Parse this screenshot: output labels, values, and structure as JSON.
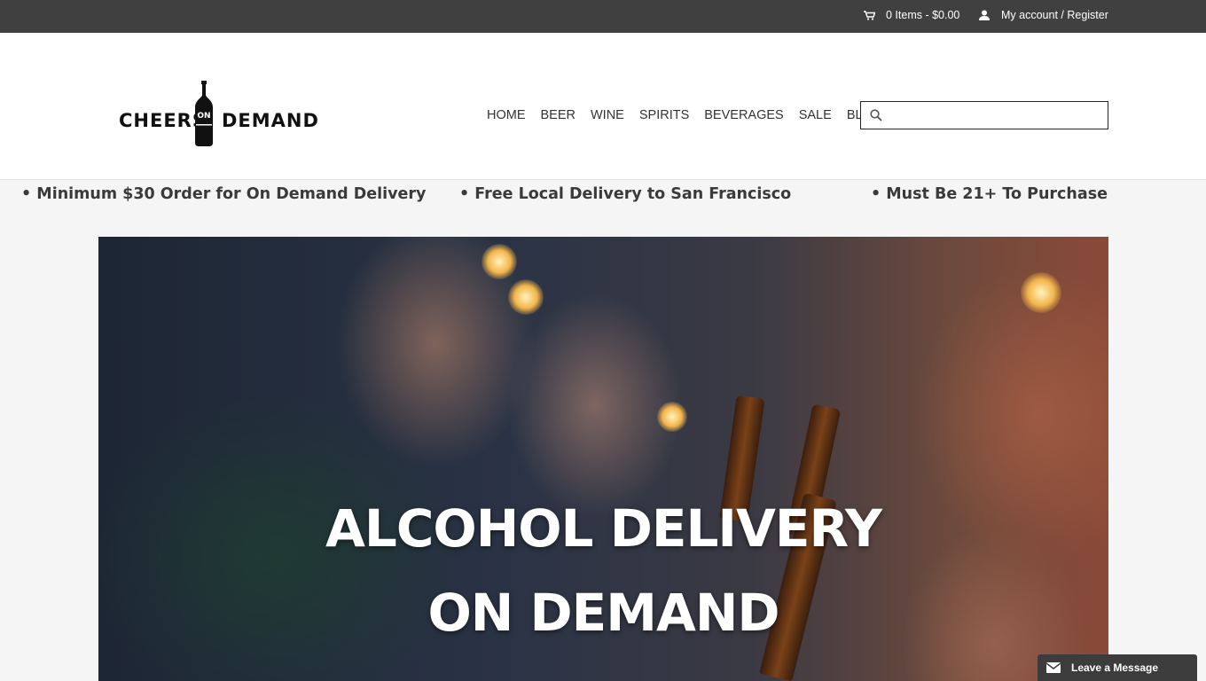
{
  "topbar": {
    "cart_label": "0 Items - $0.00",
    "account_label": "My account / Register"
  },
  "brand": {
    "logo_word_1": "CHEERS",
    "logo_word_2": "DEMAND",
    "logo_badge": "ON"
  },
  "nav": {
    "items": [
      {
        "label": "HOME"
      },
      {
        "label": "BEER"
      },
      {
        "label": "WINE"
      },
      {
        "label": "SPIRITS"
      },
      {
        "label": "BEVERAGES"
      },
      {
        "label": "SALE"
      },
      {
        "label": "BLOG"
      }
    ]
  },
  "search": {
    "value": "",
    "placeholder": ""
  },
  "usps": [
    {
      "text": "• Minimum $30 Order for On Demand Delivery"
    },
    {
      "text": "• Free Local Delivery to San Francisco"
    },
    {
      "text": "• Must Be 21+ To Purchase"
    }
  ],
  "hero": {
    "headline_line_1": "ALCOHOL DELIVERY",
    "headline_line_2": "ON DEMAND"
  },
  "chat": {
    "label": "Leave a Message"
  },
  "colors": {
    "topbar_bg": "#404040",
    "page_bg": "#f5f5f5",
    "header_bg": "#ffffff",
    "chat_bg": "#3c3c3c"
  }
}
